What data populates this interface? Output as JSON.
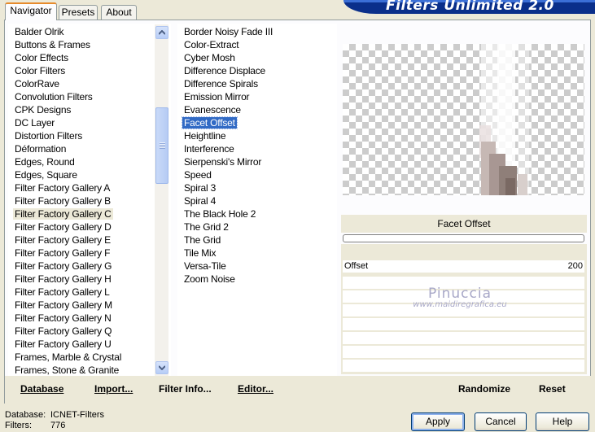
{
  "banner": {
    "title": "Filters Unlimited 2.0"
  },
  "tabs": [
    "Navigator",
    "Presets",
    "About"
  ],
  "categories": [
    "Balder Olrik",
    "Buttons & Frames",
    "Color Effects",
    "Color Filters",
    "ColorRave",
    "Convolution Filters",
    "CPK Designs",
    "DC Layer",
    "Distortion Filters",
    "Déformation",
    "Edges, Round",
    "Edges, Square",
    "Filter Factory Gallery A",
    "Filter Factory Gallery B",
    "Filter Factory Gallery C",
    "Filter Factory Gallery D",
    "Filter Factory Gallery E",
    "Filter Factory Gallery F",
    "Filter Factory Gallery G",
    "Filter Factory Gallery H",
    "Filter Factory Gallery L",
    "Filter Factory Gallery M",
    "Filter Factory Gallery N",
    "Filter Factory Gallery Q",
    "Filter Factory Gallery U",
    "Frames, Marble & Crystal",
    "Frames, Stone & Granite"
  ],
  "selected_category": "Filter Factory Gallery C",
  "filters": [
    "Border Noisy Fade III",
    "Color-Extract",
    "Cyber Mosh",
    "Difference Displace",
    "Difference Spirals",
    "Emission Mirror",
    "Evanescence",
    "Facet Offset",
    "Heightline",
    "Interference",
    "Sierpenski's Mirror",
    "Speed",
    "Spiral 3",
    "Spiral 4",
    "The Black Hole 2",
    "The Grid 2",
    "The Grid",
    "Tile Mix",
    "Versa-Tile",
    "Zoom Noise"
  ],
  "selected_filter": "Facet Offset",
  "preview": {
    "filter_name": "Facet Offset",
    "progress": 0
  },
  "sliders": [
    {
      "label": "Offset",
      "value": "200"
    }
  ],
  "watermark": {
    "name": "Pinuccia",
    "url": "www.maidiregrafica.eu"
  },
  "toolbar": {
    "database": "Database",
    "import": "Import...",
    "filter_info": "Filter Info...",
    "editor": "Editor...",
    "randomize": "Randomize",
    "reset": "Reset"
  },
  "status": {
    "database_label": "Database:",
    "database_value": "ICNET-Filters",
    "filters_label": "Filters:",
    "filters_value": "776"
  },
  "buttons": {
    "apply": "Apply",
    "cancel": "Cancel",
    "help": "Help"
  },
  "colors": {
    "selection": "#316ac5",
    "banner": "#0a2f8a",
    "window": "#ece9d8"
  }
}
